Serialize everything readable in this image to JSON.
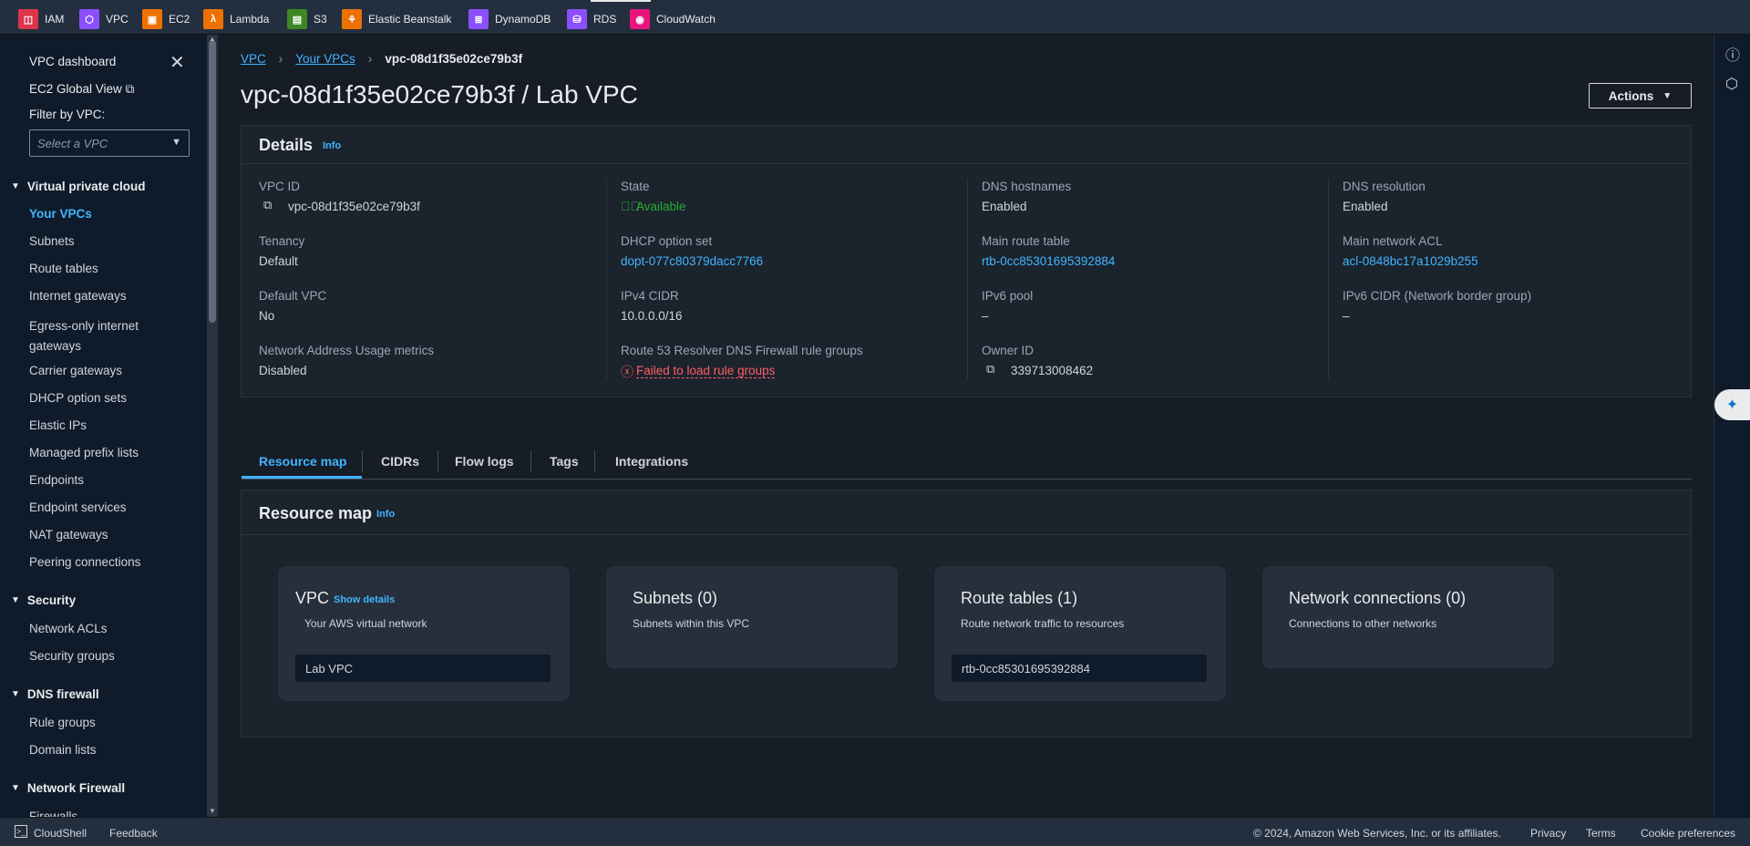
{
  "topbar": {
    "favorites": [
      {
        "label": "IAM",
        "color": "#dd344c",
        "glyph": "◫",
        "icon": "iam-icon"
      },
      {
        "label": "VPC",
        "color": "#8c4fff",
        "glyph": "⬡",
        "icon": "vpc-icon"
      },
      {
        "label": "EC2",
        "color": "#ed7100",
        "glyph": "▣",
        "icon": "ec2-icon"
      },
      {
        "label": "Lambda",
        "color": "#ed7100",
        "glyph": "λ",
        "icon": "lambda-icon"
      },
      {
        "label": "S3",
        "color": "#3f8624",
        "glyph": "▤",
        "icon": "s3-icon"
      },
      {
        "label": "Elastic Beanstalk",
        "color": "#ed7100",
        "glyph": "⚘",
        "icon": "elastic-beanstalk-icon"
      },
      {
        "label": "DynamoDB",
        "color": "#8c4fff",
        "glyph": "≣",
        "icon": "dynamodb-icon"
      },
      {
        "label": "RDS",
        "color": "#8c4fff",
        "glyph": "⛁",
        "icon": "rds-icon"
      },
      {
        "label": "CloudWatch",
        "color": "#e7157b",
        "glyph": "◉",
        "icon": "cloudwatch-icon"
      }
    ]
  },
  "sidebar": {
    "dashboard": "VPC dashboard",
    "ec2_global": "EC2 Global View",
    "filter_label": "Filter by VPC:",
    "filter_placeholder": "Select a VPC",
    "sections": [
      {
        "title": "Virtual private cloud",
        "items": [
          "Your VPCs",
          "Subnets",
          "Route tables",
          "Internet gateways",
          "Egress-only internet gateways",
          "Carrier gateways",
          "DHCP option sets",
          "Elastic IPs",
          "Managed prefix lists",
          "Endpoints",
          "Endpoint services",
          "NAT gateways",
          "Peering connections"
        ]
      },
      {
        "title": "Security",
        "items": [
          "Network ACLs",
          "Security groups"
        ]
      },
      {
        "title": "DNS firewall",
        "items": [
          "Rule groups",
          "Domain lists"
        ]
      },
      {
        "title": "Network Firewall",
        "items": [
          "Firewalls"
        ]
      }
    ]
  },
  "breadcrumb": {
    "items": [
      "VPC",
      "Your VPCs",
      "vpc-08d1f35e02ce79b3f"
    ]
  },
  "page": {
    "title": "vpc-08d1f35e02ce79b3f / Lab VPC",
    "actions": "Actions"
  },
  "details": {
    "heading": "Details",
    "info": "Info",
    "vpc_id": {
      "label": "VPC ID",
      "value": "vpc-08d1f35e02ce79b3f"
    },
    "state": {
      "label": "State",
      "value": "Available"
    },
    "dns_hostnames": {
      "label": "DNS hostnames",
      "value": "Enabled"
    },
    "dns_resolution": {
      "label": "DNS resolution",
      "value": "Enabled"
    },
    "tenancy": {
      "label": "Tenancy",
      "value": "Default"
    },
    "dhcp": {
      "label": "DHCP option set",
      "value": "dopt-077c80379dacc7766"
    },
    "main_route_table": {
      "label": "Main route table",
      "value": "rtb-0cc85301695392884"
    },
    "main_acl": {
      "label": "Main network ACL",
      "value": "acl-0848bc17a1029b255"
    },
    "default_vpc": {
      "label": "Default VPC",
      "value": "No"
    },
    "ipv4_cidr": {
      "label": "IPv4 CIDR",
      "value": "10.0.0.0/16"
    },
    "ipv6_pool": {
      "label": "IPv6 pool",
      "value": "–"
    },
    "ipv6_cidr": {
      "label": "IPv6 CIDR (Network border group)",
      "value": "–"
    },
    "nau": {
      "label": "Network Address Usage metrics",
      "value": "Disabled"
    },
    "route53": {
      "label": "Route 53 Resolver DNS Firewall rule groups",
      "value": "Failed to load rule groups"
    },
    "owner": {
      "label": "Owner ID",
      "value": "339713008462"
    }
  },
  "tabs": [
    "Resource map",
    "CIDRs",
    "Flow logs",
    "Tags",
    "Integrations"
  ],
  "resource_map": {
    "heading": "Resource map",
    "info": "Info",
    "vpc": {
      "title": "VPC",
      "show": "Show details",
      "desc": "Your AWS virtual network",
      "item": "Lab VPC"
    },
    "subnets": {
      "title": "Subnets (0)",
      "desc": "Subnets within this VPC"
    },
    "routes": {
      "title": "Route tables (1)",
      "desc": "Route network traffic to resources",
      "item": "rtb-0cc85301695392884"
    },
    "network": {
      "title": "Network connections (0)",
      "desc": "Connections to other networks"
    }
  },
  "footer": {
    "cloudshell": "CloudShell",
    "feedback": "Feedback",
    "copyright": "© 2024, Amazon Web Services, Inc. or its affiliates.",
    "privacy": "Privacy",
    "terms": "Terms",
    "cookies": "Cookie preferences"
  }
}
